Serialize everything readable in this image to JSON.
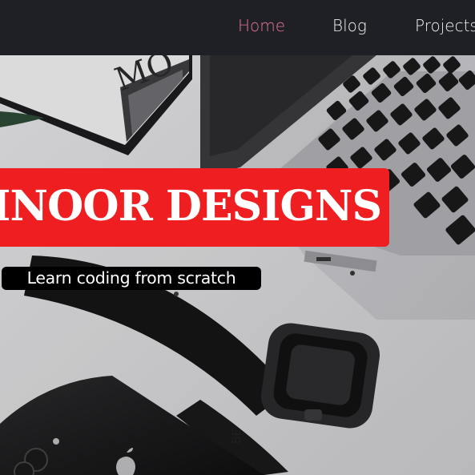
{
  "nav": {
    "items": [
      {
        "label": "Home",
        "active": true
      },
      {
        "label": "Blog",
        "active": false
      },
      {
        "label": "Projects",
        "active": false
      }
    ]
  },
  "hero": {
    "title": "INOOR DESIGNS",
    "tagline": "Learn coding from scratch",
    "background_description_icons": [
      "laptop-keyboard",
      "smartwatch",
      "smartphone",
      "magazines",
      "plant-leaf"
    ]
  },
  "colors": {
    "navbar_bg": "#1f2025",
    "nav_text": "#f2f2f2",
    "nav_active": "#e67597",
    "banner_red": "#ee1e21",
    "tagline_bg": "#000000",
    "text_white": "#ffffff"
  }
}
